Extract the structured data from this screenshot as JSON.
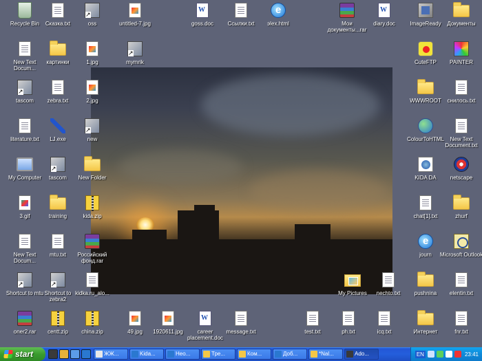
{
  "desktop": {
    "background": "#5e6377",
    "icons": [
      {
        "label": "Recycle Bin",
        "glyph": "recycle"
      },
      {
        "label": "Сказка.txt",
        "glyph": "doc"
      },
      {
        "label": "oss",
        "glyph": "shortcut"
      },
      {
        "label": "untitled-7.jpg",
        "glyph": "img"
      },
      {
        "label": "goss.doc",
        "glyph": "word"
      },
      {
        "label": "Ссылки.txt",
        "glyph": "doc"
      },
      {
        "label": "эlex.html",
        "glyph": "ie"
      },
      {
        "label": "Мои документы...rar",
        "glyph": "rar"
      },
      {
        "label": "diary.doc",
        "glyph": "word"
      },
      {
        "label": "ImageReady",
        "glyph": "exe"
      },
      {
        "label": "Документы",
        "glyph": "folder"
      },
      {
        "label": "New Text Docum...",
        "glyph": "doc"
      },
      {
        "label": "картинки",
        "glyph": "folder"
      },
      {
        "label": "1.jpg",
        "glyph": "img"
      },
      {
        "label": "mymrik",
        "glyph": "shortcut"
      },
      {
        "label": "CuteFTP",
        "glyph": "ftp"
      },
      {
        "label": "PAINTER",
        "glyph": "painter"
      },
      {
        "label": "tascom",
        "glyph": "shortcut"
      },
      {
        "label": "zebra.txt",
        "glyph": "doc"
      },
      {
        "label": "2.jpg",
        "glyph": "img"
      },
      {
        "label": "WWWROOT",
        "glyph": "folder"
      },
      {
        "label": "снилось.txt",
        "glyph": "doc"
      },
      {
        "label": "literature.txt",
        "glyph": "doc"
      },
      {
        "label": "LJ.exe",
        "glyph": "pencil"
      },
      {
        "label": "new",
        "glyph": "shortcut"
      },
      {
        "label": "ColourToHTML",
        "glyph": "globe"
      },
      {
        "label": "New Text Document.txt",
        "glyph": "doc"
      },
      {
        "label": "My Computer",
        "glyph": "comp"
      },
      {
        "label": "tascom",
        "glyph": "shortcut"
      },
      {
        "label": "New Folder",
        "glyph": "folder"
      },
      {
        "label": "KIDA DA",
        "glyph": "html"
      },
      {
        "label": "netscape",
        "glyph": "ns"
      },
      {
        "label": "3.gif",
        "glyph": "gif"
      },
      {
        "label": "training",
        "glyph": "folder"
      },
      {
        "label": "kida.zip",
        "glyph": "zip"
      },
      {
        "label": "chat[1].txt",
        "glyph": "doc"
      },
      {
        "label": "zhurf",
        "glyph": "folder"
      },
      {
        "label": "New Text Docum...",
        "glyph": "doc"
      },
      {
        "label": "mtu.txt",
        "glyph": "doc"
      },
      {
        "label": "Российский фонд.rar",
        "glyph": "rar"
      },
      {
        "label": "journ",
        "glyph": "ie"
      },
      {
        "label": "Microsoft Outlook",
        "glyph": "outlook"
      },
      {
        "label": "Shortcut to mtu",
        "glyph": "shortcut"
      },
      {
        "label": "Shortcut to zebra2",
        "glyph": "shortcut"
      },
      {
        "label": "kidka.ru_alo...",
        "glyph": "doc"
      },
      {
        "label": "My Pictures",
        "glyph": "mypics"
      },
      {
        "label": "nechto.txt",
        "glyph": "doc"
      },
      {
        "label": "pushnina",
        "glyph": "folder"
      },
      {
        "label": "elentin.txt",
        "glyph": "doc"
      },
      {
        "label": "oner2.rar",
        "glyph": "rar"
      },
      {
        "label": "centt.zip",
        "glyph": "zip"
      },
      {
        "label": "china.zip",
        "glyph": "zip"
      },
      {
        "label": "49.jpg",
        "glyph": "img"
      },
      {
        "label": "1920611.jpg",
        "glyph": "img"
      },
      {
        "label": "career placement.doc",
        "glyph": "word"
      },
      {
        "label": "message.txt",
        "glyph": "doc"
      },
      {
        "label": "test.txt",
        "glyph": "doc"
      },
      {
        "label": "ph.txt",
        "glyph": "doc"
      },
      {
        "label": "icq.txt",
        "glyph": "doc"
      },
      {
        "label": "Интернет",
        "glyph": "folder"
      },
      {
        "label": "fnr.txt",
        "glyph": "doc"
      }
    ]
  },
  "taskbar": {
    "start_label": "start",
    "quicklaunch": [
      {
        "name": "desktop-icon",
        "color": "#3a3a3a"
      },
      {
        "name": "browser-icon",
        "color": "#e8b33a"
      },
      {
        "name": "media-icon",
        "color": "#5b9ce8"
      },
      {
        "name": "ie-icon",
        "color": "#2a78d0"
      }
    ],
    "tasks": [
      {
        "label": "ЖЖ...",
        "color": "#e8e8e8"
      },
      {
        "label": "Kida...",
        "color": "#2a78d0"
      },
      {
        "label": "Нео...",
        "color": "#2a78d0"
      },
      {
        "label": "Тре...",
        "color": "#f4c748"
      },
      {
        "label": "Ком...",
        "color": "#f4c748"
      },
      {
        "label": "Доб...",
        "color": "#2a78d0"
      },
      {
        "label": "*Nal...",
        "color": "#f4c748"
      },
      {
        "label": "Ado...",
        "color": "#3a3a3a"
      }
    ],
    "tray": {
      "lang": "EN",
      "icons": [
        {
          "name": "network-icon",
          "color": "#cfe2ff"
        },
        {
          "name": "messenger-icon",
          "color": "#5ccf5c"
        },
        {
          "name": "volume-icon",
          "color": "#ffffff"
        },
        {
          "name": "antivirus-icon",
          "color": "#e33"
        }
      ],
      "clock": "23:41"
    }
  }
}
